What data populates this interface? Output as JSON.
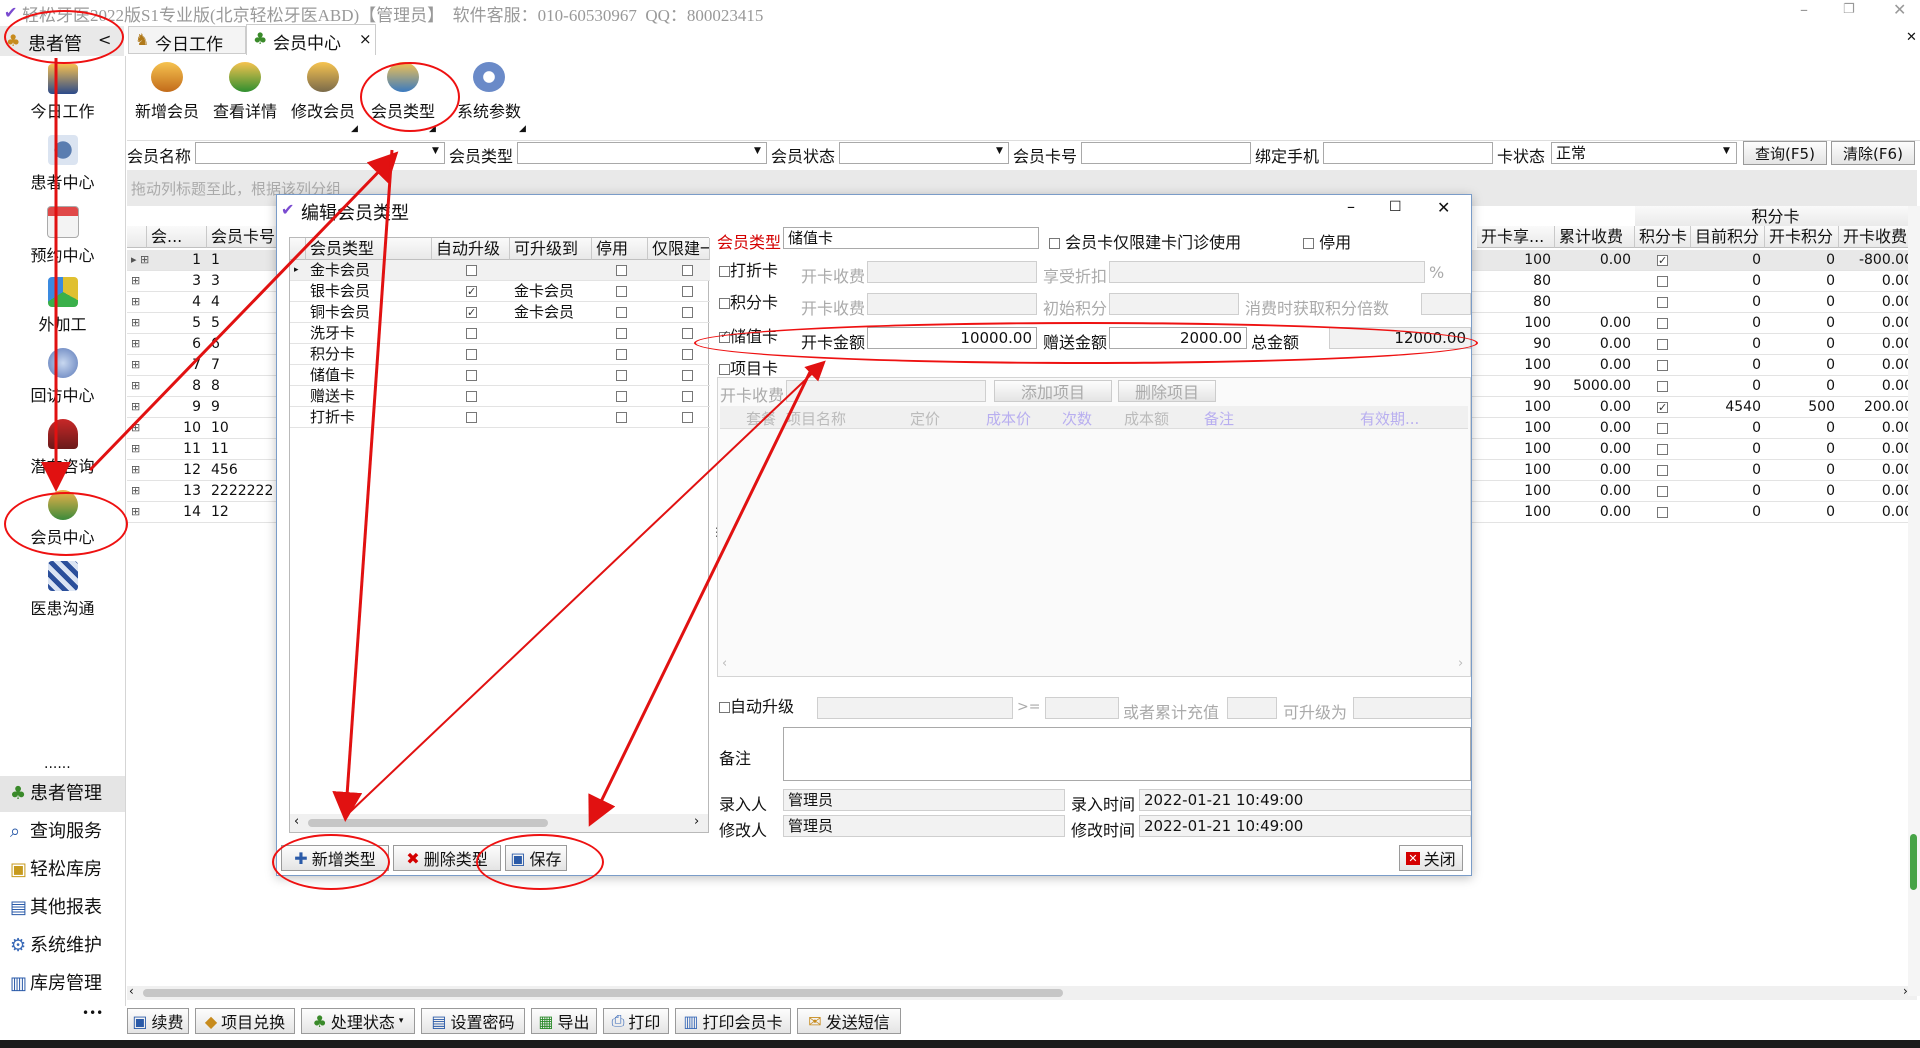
{
  "titlebar": {
    "title": "轻松牙医2022版S1专业版(北京轻松牙医ABD)【管理员】  软件客服：010-60530967  QQ：800023415"
  },
  "nav": {
    "header_label": "患者管",
    "collapse": "<"
  },
  "tabs": [
    {
      "label": "今日工作"
    },
    {
      "label": "会员中心",
      "close": "×"
    }
  ],
  "sidebar": {
    "items": [
      {
        "label": "今日工作",
        "icon": "worker-icon"
      },
      {
        "label": "患者中心",
        "icon": "binoculars-icon"
      },
      {
        "label": "预约中心",
        "icon": "calendar-icon"
      },
      {
        "label": "外加工",
        "icon": "cubes-icon"
      },
      {
        "label": "回访中心",
        "icon": "globe-icon"
      },
      {
        "label": "潜在咨询",
        "icon": "consult-icon"
      },
      {
        "label": "会员中心",
        "icon": "members-icon"
      },
      {
        "label": "医患沟通",
        "icon": "clapper-icon"
      }
    ],
    "more": "......",
    "bottom": [
      "患者管理",
      "查询服务",
      "轻松库房",
      "其他报表",
      "系统维护",
      "库房管理"
    ],
    "ellipsis": "•••"
  },
  "toolbar": {
    "buttons": [
      "新增会员",
      "查看详情",
      "修改会员",
      "会员类型",
      "系统参数"
    ]
  },
  "filters": {
    "member_name": "会员名称",
    "member_type": "会员类型",
    "member_status": "会员状态",
    "card_no": "会员卡号",
    "phone": "绑定手机",
    "card_status": "卡状态",
    "card_status_value": "正常",
    "query": "查询(F5)",
    "clear": "清除(F6)"
  },
  "group_hint": "拖动列标题至此，根据该列分组",
  "main_grid": {
    "left_headers": [
      "会...",
      "会员卡号"
    ],
    "right_group": "积分卡",
    "right_headers": [
      "开卡享...",
      "累计收费",
      "积分卡",
      "目前积分",
      "开卡积分",
      "开卡收费"
    ],
    "rows": [
      {
        "n": "1",
        "card": "1",
        "share": "100",
        "total": "0.00",
        "pt": true,
        "cur": "0",
        "open": "0",
        "fee": "-800.00"
      },
      {
        "n": "3",
        "card": "3",
        "share": "80",
        "total": "",
        "pt": false,
        "cur": "0",
        "open": "0",
        "fee": "0.00"
      },
      {
        "n": "4",
        "card": "4",
        "share": "80",
        "total": "",
        "pt": false,
        "cur": "0",
        "open": "0",
        "fee": "0.00"
      },
      {
        "n": "5",
        "card": "5",
        "share": "100",
        "total": "0.00",
        "pt": false,
        "cur": "0",
        "open": "0",
        "fee": "0.00"
      },
      {
        "n": "6",
        "card": "6",
        "share": "90",
        "total": "0.00",
        "pt": false,
        "cur": "0",
        "open": "0",
        "fee": "0.00"
      },
      {
        "n": "7",
        "card": "7",
        "share": "100",
        "total": "0.00",
        "pt": false,
        "cur": "0",
        "open": "0",
        "fee": "0.00"
      },
      {
        "n": "8",
        "card": "8",
        "share": "90",
        "total": "5000.00",
        "pt": false,
        "cur": "0",
        "open": "0",
        "fee": "0.00"
      },
      {
        "n": "9",
        "card": "9",
        "share": "100",
        "total": "0.00",
        "pt": true,
        "cur": "4540",
        "open": "500",
        "fee": "200.00"
      },
      {
        "n": "10",
        "card": "10",
        "share": "100",
        "total": "0.00",
        "pt": false,
        "cur": "0",
        "open": "0",
        "fee": "0.00"
      },
      {
        "n": "11",
        "card": "11",
        "share": "100",
        "total": "0.00",
        "pt": false,
        "cur": "0",
        "open": "0",
        "fee": "0.00"
      },
      {
        "n": "12",
        "card": "456",
        "share": "100",
        "total": "0.00",
        "pt": false,
        "cur": "0",
        "open": "0",
        "fee": "0.00"
      },
      {
        "n": "13",
        "card": "2222222",
        "share": "100",
        "total": "0.00",
        "pt": false,
        "cur": "0",
        "open": "0",
        "fee": "0.00"
      },
      {
        "n": "14",
        "card": "12",
        "share": "100",
        "total": "0.00",
        "pt": false,
        "cur": "0",
        "open": "0",
        "fee": "0.00"
      }
    ]
  },
  "dialog": {
    "title": "编辑会员类型",
    "list_headers": [
      "会员类型",
      "自动升级",
      "可升级到",
      "停用",
      "仅限建一"
    ],
    "list_rows": [
      {
        "name": "金卡会员",
        "auto": false,
        "to": "",
        "stop": false,
        "only": false
      },
      {
        "name": "银卡会员",
        "auto": true,
        "to": "金卡会员",
        "stop": false,
        "only": false
      },
      {
        "name": "铜卡会员",
        "auto": true,
        "to": "金卡会员",
        "stop": false,
        "only": false
      },
      {
        "name": "洗牙卡",
        "auto": false,
        "to": "",
        "stop": false,
        "only": false
      },
      {
        "name": "积分卡",
        "auto": false,
        "to": "",
        "stop": false,
        "only": false
      },
      {
        "name": "储值卡",
        "auto": false,
        "to": "",
        "stop": false,
        "only": false
      },
      {
        "name": "赠送卡",
        "auto": false,
        "to": "",
        "stop": false,
        "only": false
      },
      {
        "name": "打折卡",
        "auto": false,
        "to": "",
        "stop": false,
        "only": false
      }
    ],
    "form": {
      "type_label": "会员类型",
      "type_value": "储值卡",
      "only_clinic": "会员卡仅限建卡门诊使用",
      "disabled": "停用",
      "discount_card": "打折卡",
      "open_fee": "开卡收费",
      "discount": "享受折扣",
      "percent": "%",
      "points_card": "积分卡",
      "initial_points": "初始积分",
      "multiplier": "消费时获取积分倍数",
      "stored_card": "储值卡",
      "open_amount": "开卡金额",
      "open_amount_value": "10000.00",
      "gift_amount": "赠送金额",
      "gift_amount_value": "2000.00",
      "total_amount": "总金额",
      "total_amount_value": "12000.00",
      "item_card": "项目卡",
      "item_open_fee": "开卡收费",
      "add_item": "添加项目",
      "delete_item": "删除项目",
      "item_headers": [
        "套餐",
        "项目名称",
        "定价",
        "成本价",
        "次数",
        "成本额",
        "备注",
        "有效期..."
      ],
      "auto_upgrade": "自动升级",
      "gte": ">=",
      "or_recharge": "或者累计充值",
      "upgrade_to": "可升级为",
      "remark": "备注",
      "creator_label": "录入人",
      "creator": "管理员",
      "create_time_label": "录入时间",
      "create_time": "2022-01-21 10:49:00",
      "modifier_label": "修改人",
      "modifier": "管理员",
      "modify_time_label": "修改时间",
      "modify_time": "2022-01-21 10:49:00"
    },
    "buttons": {
      "add": "新增类型",
      "delete": "删除类型",
      "save": "保存",
      "close": "关闭"
    }
  },
  "bottom_bar": [
    "续费",
    "项目兑换",
    "处理状态",
    "设置密码",
    "导出",
    "打印",
    "打印会员卡",
    "发送短信"
  ],
  "colors": {
    "accent_red": "#e11111",
    "required_label": "#d40000"
  }
}
